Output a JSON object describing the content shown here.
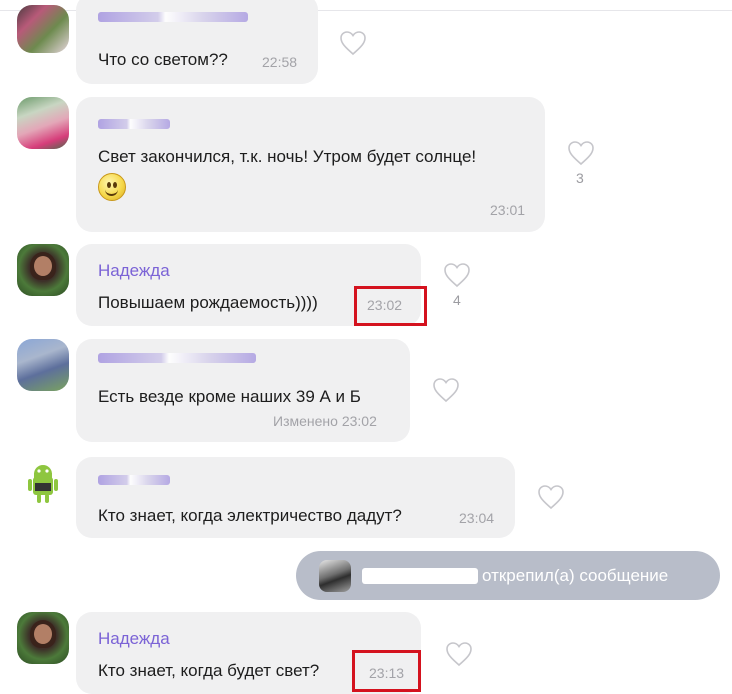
{
  "messages": [
    {
      "author": "",
      "text": "Что со светом??",
      "time": "22:58",
      "likes": ""
    },
    {
      "author": "",
      "text": "Свет закончился, т.к. ночь! Утром будет солнце!",
      "emoji": "smile",
      "time": "23:01",
      "likes": "3"
    },
    {
      "author": "Надежда",
      "text": "Повышаем рождаемость))))",
      "time": "23:02",
      "likes": "4",
      "highlighted": true
    },
    {
      "author": "",
      "text": "Есть везде кроме наших 39 А и Б",
      "time": "Изменено 23:02",
      "likes": ""
    },
    {
      "author": "",
      "text": "Кто знает, когда электричество дадут?",
      "time": "23:04",
      "likes": ""
    },
    {
      "author": "Надежда",
      "text": "Кто знает, когда будет свет?",
      "time": "23:13",
      "likes": "",
      "highlighted": true
    }
  ],
  "system": {
    "text": "открепил(а) сообщение",
    "actor": ""
  },
  "colors": {
    "author": "#7b63d6",
    "bubble": "#f0f0f1",
    "system_bubble": "#b8bdc9",
    "highlight": "#d4121e",
    "timestamp": "#a3a3a8"
  },
  "icons": {
    "like": "heart-outline-icon",
    "emoji": "smiley-emoji-icon"
  }
}
